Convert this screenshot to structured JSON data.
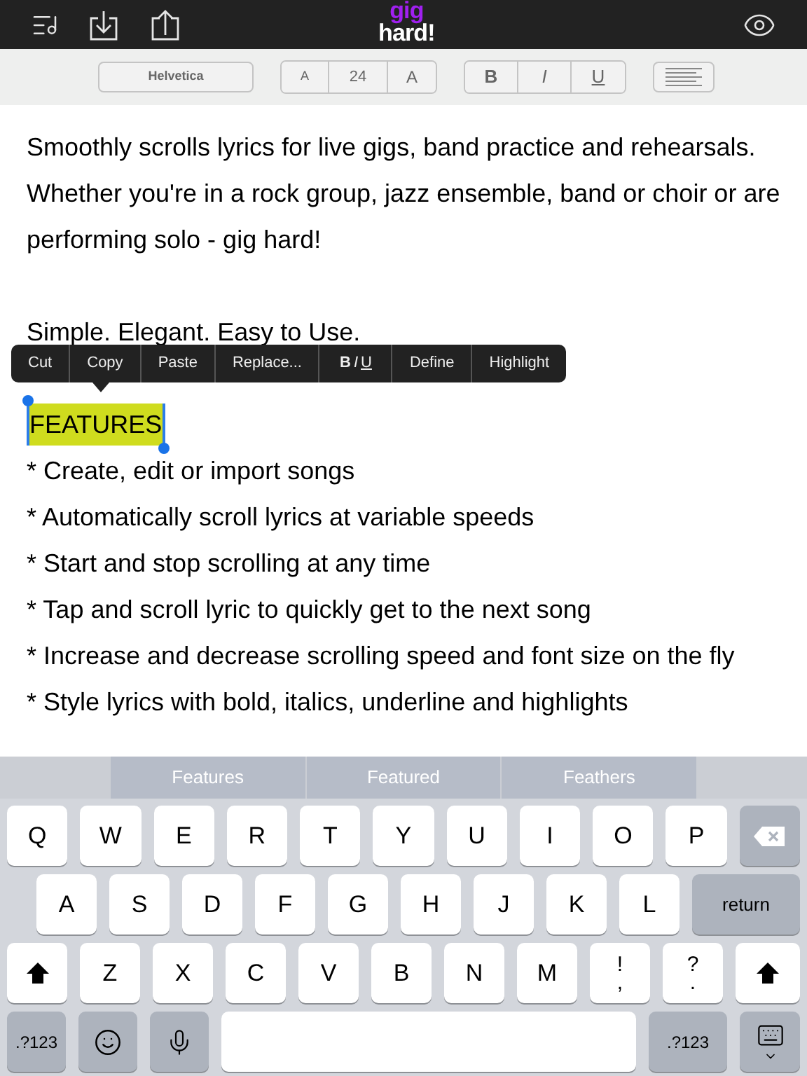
{
  "top_bar": {
    "logo": {
      "top": "gig",
      "bottom": "hard!"
    }
  },
  "format_bar": {
    "font": "Helvetica",
    "size": {
      "smaller": "A",
      "value": "24",
      "larger": "A"
    },
    "styles": [
      {
        "kind": "bold",
        "label": "B"
      },
      {
        "kind": "italic",
        "label": "I"
      },
      {
        "kind": "underline",
        "label": "U"
      }
    ]
  },
  "lyrics": [
    {
      "lines": [
        {
          "text": "Smoothly scrolls lyrics for live gigs, band practice and rehearsals. Whether you're in a rock group, jazz ensemble, band or choir or are performing solo - gig hard!",
          "selected": false
        }
      ]
    },
    {
      "lines": [
        {
          "text": "Simple. Elegant. Easy to Use.",
          "selected": false
        }
      ]
    },
    {
      "lines": [
        {
          "text": "FEATURES",
          "selected": true
        },
        {
          "text": "* Create, edit or import songs",
          "selected": false
        },
        {
          "text": "* Automatically scroll lyrics at variable speeds",
          "selected": false
        },
        {
          "text": "* Start and stop scrolling at any time",
          "selected": false
        },
        {
          "text": "* Tap and scroll lyric to quickly get to the next song",
          "selected": false
        },
        {
          "text": "* Increase and decrease scrolling speed and font size on the fly",
          "selected": false
        },
        {
          "text": "* Style lyrics with bold, italics, underline and highlights",
          "selected": false
        }
      ]
    }
  ],
  "edit_menu": [
    {
      "kind": "text",
      "label": "Cut"
    },
    {
      "kind": "text",
      "label": "Copy"
    },
    {
      "kind": "text",
      "label": "Paste"
    },
    {
      "kind": "text",
      "label": "Replace..."
    },
    {
      "kind": "style",
      "letters": [
        "B",
        "I",
        "U"
      ]
    },
    {
      "kind": "text",
      "label": "Define"
    },
    {
      "kind": "text",
      "label": "Highlight"
    }
  ],
  "keyboard": {
    "suggestions": [
      "Features",
      "Featured",
      "Feathers"
    ],
    "rows": [
      [
        {
          "kind": "char",
          "label": "Q"
        },
        {
          "kind": "char",
          "label": "W"
        },
        {
          "kind": "char",
          "label": "E"
        },
        {
          "kind": "char",
          "label": "R"
        },
        {
          "kind": "char",
          "label": "T"
        },
        {
          "kind": "char",
          "label": "Y"
        },
        {
          "kind": "char",
          "label": "U"
        },
        {
          "kind": "char",
          "label": "I"
        },
        {
          "kind": "char",
          "label": "O"
        },
        {
          "kind": "char",
          "label": "P"
        },
        {
          "kind": "delete"
        }
      ],
      [
        {
          "kind": "char",
          "label": "A"
        },
        {
          "kind": "char",
          "label": "S"
        },
        {
          "kind": "char",
          "label": "D"
        },
        {
          "kind": "char",
          "label": "F"
        },
        {
          "kind": "char",
          "label": "G"
        },
        {
          "kind": "char",
          "label": "H"
        },
        {
          "kind": "char",
          "label": "J"
        },
        {
          "kind": "char",
          "label": "K"
        },
        {
          "kind": "char",
          "label": "L"
        },
        {
          "kind": "return",
          "label": "return"
        }
      ],
      [
        {
          "kind": "shift"
        },
        {
          "kind": "char",
          "label": "Z"
        },
        {
          "kind": "char",
          "label": "X"
        },
        {
          "kind": "char",
          "label": "C"
        },
        {
          "kind": "char",
          "label": "V"
        },
        {
          "kind": "char",
          "label": "B"
        },
        {
          "kind": "char",
          "label": "N"
        },
        {
          "kind": "char",
          "label": "M"
        },
        {
          "kind": "dual",
          "top": "!",
          "bottom": ","
        },
        {
          "kind": "dual",
          "top": "?",
          "bottom": "."
        },
        {
          "kind": "shift"
        }
      ]
    ],
    "bottom_row": [
      {
        "kind": "numbers",
        "label": ".?123"
      },
      {
        "kind": "emoji"
      },
      {
        "kind": "mic"
      },
      {
        "kind": "space"
      },
      {
        "kind": "numbers",
        "label": ".?123"
      },
      {
        "kind": "hide"
      }
    ]
  }
}
